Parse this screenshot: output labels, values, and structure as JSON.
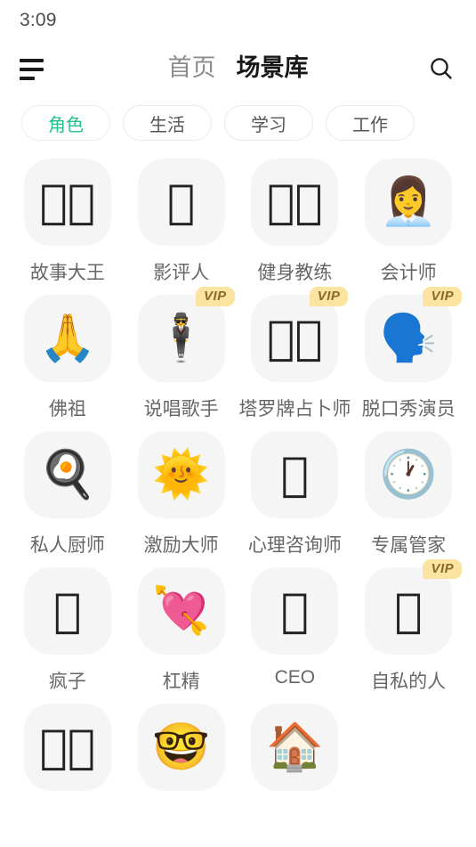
{
  "status_bar": {
    "time": "3:09"
  },
  "header": {
    "menu_icon": "hamburger-icon",
    "search_icon": "search-icon",
    "tabs": [
      {
        "label": "首页",
        "active": false
      },
      {
        "label": "场景库",
        "active": true
      }
    ]
  },
  "filters": {
    "chips": [
      {
        "label": "角色",
        "active": true
      },
      {
        "label": "生活",
        "active": false
      },
      {
        "label": "学习",
        "active": false
      },
      {
        "label": "工作",
        "active": false
      }
    ],
    "active_color": "#25c08b"
  },
  "colors": {
    "tile_background": "#f5f5f5",
    "label_text": "#666666",
    "vip_background": "#fbe3a0",
    "vip_text": "#8a6a28",
    "accent_green": "#25c08b",
    "page_background": "#ffffff"
  },
  "grid": {
    "columns": 4,
    "items": [
      {
        "label": "故事大王",
        "glyph": "􌫖􌫗",
        "icon": "missing-glyph-icon",
        "vip": false,
        "vip_label": ""
      },
      {
        "label": "影评人",
        "glyph": "􌫘",
        "icon": "missing-glyph-icon",
        "vip": false,
        "vip_label": ""
      },
      {
        "label": "健身教练",
        "glyph": "􌫙􌫚",
        "icon": "missing-glyph-icon",
        "vip": false,
        "vip_label": ""
      },
      {
        "label": "会计师",
        "glyph": "👩‍💼",
        "icon": "woman-office-worker-emoji",
        "vip": false,
        "vip_label": ""
      },
      {
        "label": "佛祖",
        "glyph": "🙏",
        "icon": "folded-hands-emoji",
        "vip": false,
        "vip_label": ""
      },
      {
        "label": "说唱歌手",
        "glyph": "🕴️",
        "icon": "person-in-suit-levitating-emoji",
        "vip": true,
        "vip_label": "VIP"
      },
      {
        "label": "塔罗牌占卜师",
        "glyph": "􌫛􌫜",
        "icon": "missing-glyph-icon",
        "vip": true,
        "vip_label": "VIP"
      },
      {
        "label": "脱口秀演员",
        "glyph": "🗣️",
        "icon": "speaking-head-emoji",
        "vip": true,
        "vip_label": "VIP"
      },
      {
        "label": "私人厨师",
        "glyph": "🍳",
        "icon": "cooking-pan-emoji",
        "vip": false,
        "vip_label": ""
      },
      {
        "label": "激励大师",
        "glyph": "🌞",
        "icon": "sun-with-face-emoji",
        "vip": false,
        "vip_label": ""
      },
      {
        "label": "心理咨询师",
        "glyph": "􌫝",
        "icon": "missing-glyph-icon",
        "vip": false,
        "vip_label": ""
      },
      {
        "label": "专属管家",
        "glyph": "🕐",
        "icon": "clock-emoji",
        "vip": false,
        "vip_label": ""
      },
      {
        "label": "疯子",
        "glyph": "􌫞",
        "icon": "missing-glyph-icon",
        "vip": false,
        "vip_label": ""
      },
      {
        "label": "杠精",
        "glyph": "💘",
        "icon": "heart-with-arrow-emoji",
        "vip": false,
        "vip_label": ""
      },
      {
        "label": "CEO",
        "glyph": "􌫟",
        "icon": "missing-glyph-icon",
        "vip": false,
        "vip_label": ""
      },
      {
        "label": "自私的人",
        "glyph": "􌫠",
        "icon": "missing-glyph-icon",
        "vip": true,
        "vip_label": "VIP"
      },
      {
        "label": "",
        "glyph": "􌫡􌫢",
        "icon": "missing-glyph-icon",
        "vip": false,
        "vip_label": "",
        "partial": true
      },
      {
        "label": "",
        "glyph": "🤓",
        "icon": "nerd-face-emoji",
        "vip": false,
        "vip_label": "",
        "partial": true
      },
      {
        "label": "",
        "glyph": "🏠",
        "icon": "person-under-roof-emoji",
        "vip": false,
        "vip_label": "",
        "partial": true
      }
    ]
  }
}
